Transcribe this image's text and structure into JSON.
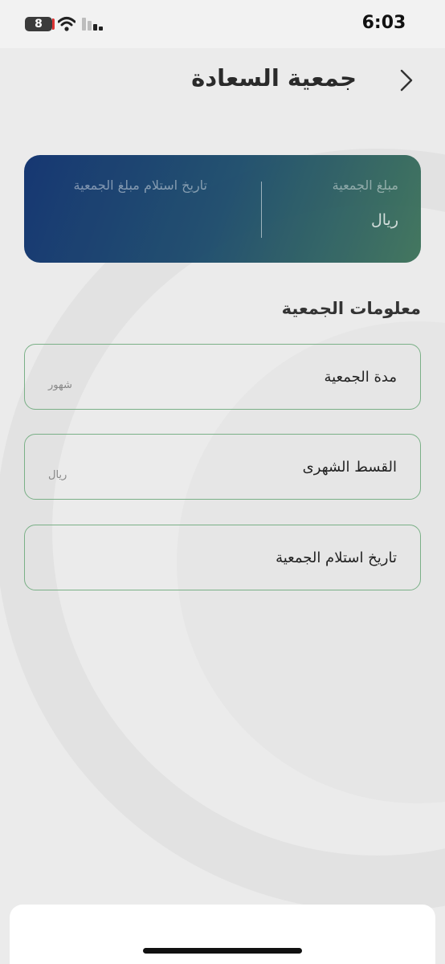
{
  "status_bar": {
    "time": "6:03",
    "battery_level": "8",
    "icons": [
      "battery-icon",
      "wifi-icon",
      "cellular-signal-icon"
    ]
  },
  "header": {
    "title": "جمعية السعادة",
    "back_icon": "chevron-right-icon"
  },
  "summary_card": {
    "amount_label": "مبلغ الجمعية",
    "amount_value": "ريال",
    "receive_date_label": "تاريخ استلام مبلغ الجمعية",
    "receive_date_value": ""
  },
  "section": {
    "title": "معلومات الجمعية"
  },
  "fields": {
    "duration": {
      "label": "مدة الجمعية",
      "unit": "شهور"
    },
    "installment": {
      "label": "القسط الشهرى",
      "unit": "ريال"
    },
    "receive_date": {
      "label": "تاريخ استلام الجمعية"
    }
  },
  "colors": {
    "card_gradient_start": "#0b2e6c",
    "card_gradient_end": "#3b7158",
    "field_border": "#7ab087",
    "overlay_background": "#ebebeb"
  }
}
